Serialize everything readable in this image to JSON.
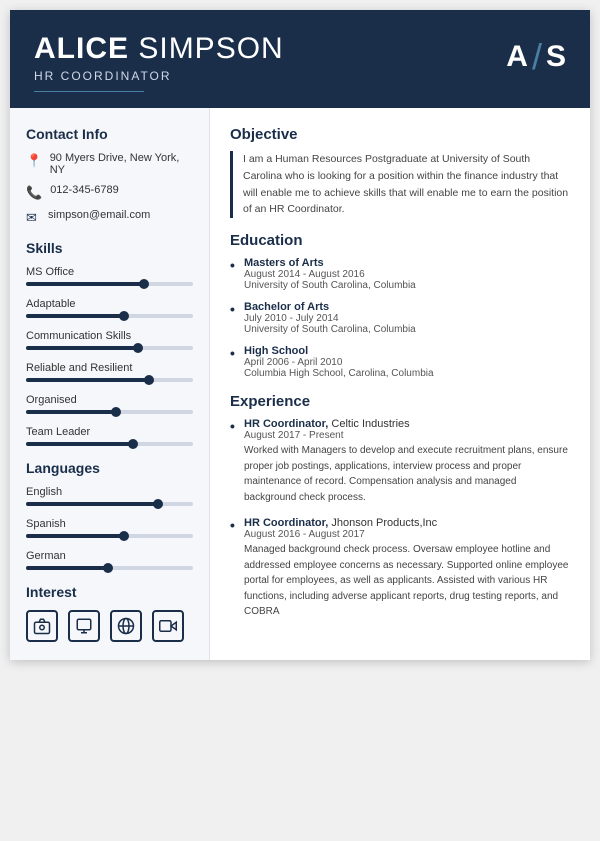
{
  "header": {
    "first_name": "ALICE",
    "last_name": "SIMPSON",
    "title": "HR COORDINATOR",
    "initial_a": "A",
    "slash": "/",
    "initial_s": "S"
  },
  "contact": {
    "section_title": "Contact Info",
    "address": "90 Myers Drive, New York, NY",
    "phone": "012-345-6789",
    "email": "simpson@email.com"
  },
  "skills": {
    "section_title": "Skills",
    "items": [
      {
        "name": "MS Office",
        "percent": 72
      },
      {
        "name": "Adaptable",
        "percent": 60
      },
      {
        "name": "Communication Skills",
        "percent": 68
      },
      {
        "name": "Reliable and Resilient",
        "percent": 75
      },
      {
        "name": "Organised",
        "percent": 55
      },
      {
        "name": "Team Leader",
        "percent": 65
      }
    ]
  },
  "languages": {
    "section_title": "Languages",
    "items": [
      {
        "name": "English",
        "percent": 80
      },
      {
        "name": "Spanish",
        "percent": 60
      },
      {
        "name": "German",
        "percent": 50
      }
    ]
  },
  "interest": {
    "section_title": "Interest",
    "icons": [
      "📷",
      "👤",
      "🌐",
      "🎬"
    ]
  },
  "objective": {
    "section_title": "Objective",
    "text": "I am a Human Resources Postgraduate at University of South Carolina who is looking for a position within the finance industry that will enable me to achieve skills that will enable me to earn the position of an HR Coordinator."
  },
  "education": {
    "section_title": "Education",
    "items": [
      {
        "degree": "Masters of Arts",
        "date": "August 2014 - August 2016",
        "school": "University of South Carolina, Columbia"
      },
      {
        "degree": "Bachelor of Arts",
        "date": "July 2010 - July 2014",
        "school": "University of South Carolina, Columbia"
      },
      {
        "degree": "High School",
        "date": "April 2006 - April 2010",
        "school": "Columbia High School, Carolina, Columbia"
      }
    ]
  },
  "experience": {
    "section_title": "Experience",
    "items": [
      {
        "title": "HR Coordinator",
        "company": "Celtic Industries",
        "date": "August 2017 - Present",
        "desc": "Worked with Managers to develop and execute recruitment plans, ensure proper job postings, applications, interview process and proper maintenance of record. Compensation analysis and managed background check process."
      },
      {
        "title": "HR Coordinator",
        "company": "Jhonson Products,Inc",
        "date": "August 2016 - August 2017",
        "desc": "Managed background check process. Oversaw employee hotline and addressed employee concerns as necessary. Supported online employee portal for employees, as well as applicants. Assisted with various HR functions, including adverse applicant reports, drug testing reports, and COBRA"
      }
    ]
  }
}
